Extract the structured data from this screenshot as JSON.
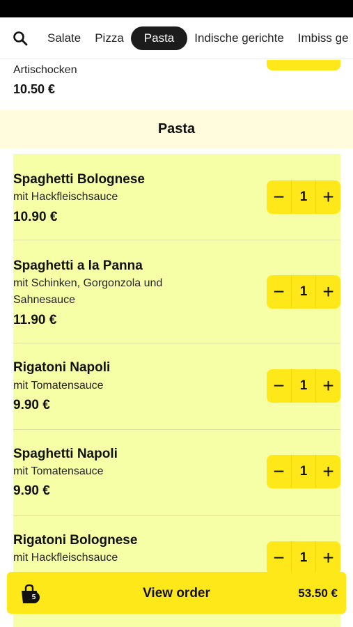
{
  "nav": {
    "items": [
      "Salate",
      "Pizza",
      "Pasta",
      "Indische gerichte",
      "Imbiss ge"
    ],
    "active": "Pasta"
  },
  "previous_item": {
    "description": "Artischocken",
    "price": "10.50 €"
  },
  "section": {
    "title": "Pasta"
  },
  "items": [
    {
      "name": "Spaghetti Bolognese",
      "description": "mit Hackfleischsauce",
      "price": "10.90 €",
      "quantity": "1"
    },
    {
      "name": "Spaghetti a la Panna",
      "description": "mit Schinken, Gorgonzola und Sahnesauce",
      "price": "11.90 €",
      "quantity": "1"
    },
    {
      "name": "Rigatoni Napoli",
      "description": "mit Tomatensauce",
      "price": "9.90 €",
      "quantity": "1"
    },
    {
      "name": "Spaghetti Napoli",
      "description": "mit Tomatensauce",
      "price": "9.90 €",
      "quantity": "1"
    },
    {
      "name": "Rigatoni Bolognese",
      "description": "mit Hackfleischsauce",
      "price": "",
      "quantity": "1"
    }
  ],
  "stepper": {
    "minus": "−",
    "plus": "+"
  },
  "order_bar": {
    "label": "View order",
    "count": "5",
    "total": "53.50 €"
  },
  "colors": {
    "accent_yellow": "#ffe81a",
    "list_background": "#f7ffa6",
    "section_background": "#fffbdc",
    "active_tab": "#1c1c1c"
  }
}
